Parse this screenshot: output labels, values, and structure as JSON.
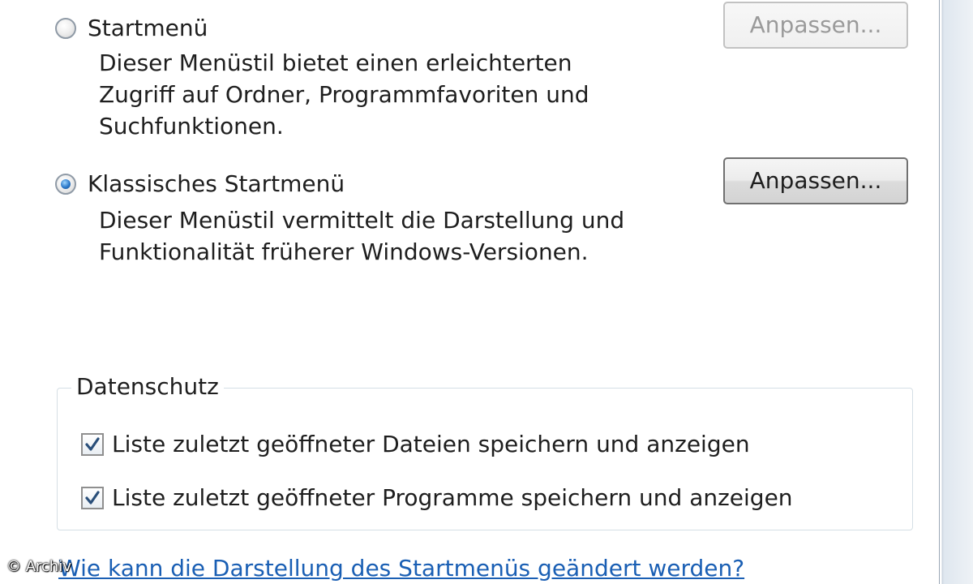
{
  "start_menu_options": [
    {
      "label": "Startmenü",
      "description_lines": [
        "Dieser Menüstil bietet einen erleichterten",
        "Zugriff auf Ordner, Programmfavoriten und",
        "Suchfunktionen."
      ],
      "selected": false,
      "button_label": "Anpassen...",
      "button_enabled": false
    },
    {
      "label": "Klassisches Startmenü",
      "description_lines": [
        "Dieser Menüstil vermittelt die Darstellung und",
        "Funktionalität früherer Windows-Versionen."
      ],
      "selected": true,
      "button_label": "Anpassen...",
      "button_enabled": true
    }
  ],
  "privacy": {
    "title": "Datenschutz",
    "items": [
      {
        "label": "Liste zuletzt geöffneter Dateien speichern und anzeigen",
        "checked": true
      },
      {
        "label": "Liste zuletzt geöffneter Programme speichern und anzeigen",
        "checked": true
      }
    ]
  },
  "help_link": "Wie kann die Darstellung des Startmenüs geändert werden?",
  "watermark": "© Archiv",
  "colors": {
    "link": "#1a5fb4",
    "radio_selected": "#2b78c9",
    "checkmark": "#2a4f7a"
  }
}
